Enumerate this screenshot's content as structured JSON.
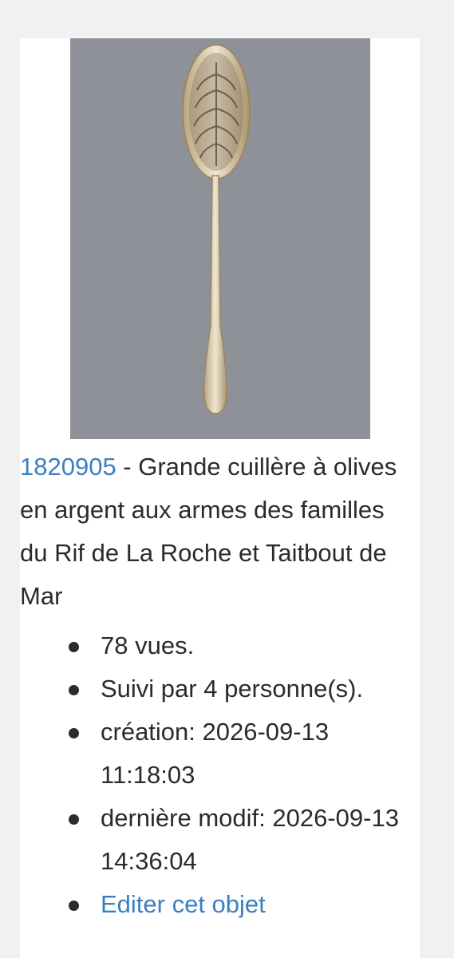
{
  "item": {
    "id": "1820905",
    "separator": " - ",
    "title": "Grande cuillère à olives en argent aux armes des familles du Rif de La Roche et Taitbout de Mar",
    "image_alt": "spoon-photo"
  },
  "stats": {
    "views": "78 vues.",
    "followers": "Suivi par 4 personne(s).",
    "created": "création: 2026-09-13 11:18:03",
    "modified": "dernière modif: 2026-09-13 14:36:04",
    "edit_link": "Editer cet objet"
  },
  "colors": {
    "link": "#3c7ec0",
    "text": "#2b2b2b",
    "photo_bg": "#8f9198"
  }
}
